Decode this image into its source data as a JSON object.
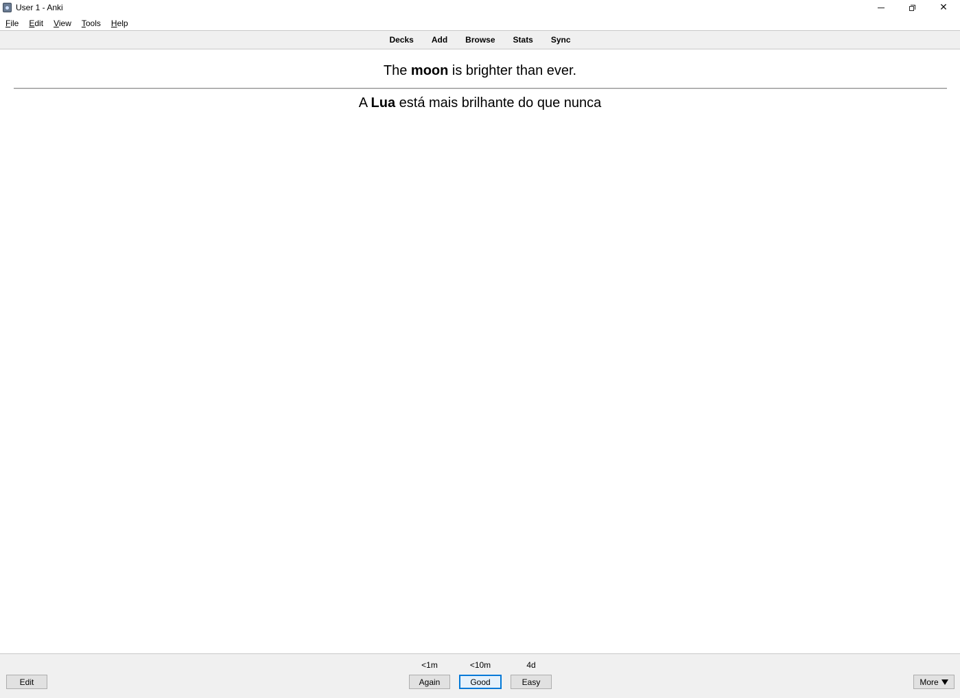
{
  "window": {
    "title": "User 1 - Anki"
  },
  "menu": [
    {
      "accel": "F",
      "rest": "ile"
    },
    {
      "accel": "E",
      "rest": "dit"
    },
    {
      "accel": "V",
      "rest": "iew"
    },
    {
      "accel": "T",
      "rest": "ools"
    },
    {
      "accel": "H",
      "rest": "elp"
    }
  ],
  "toolbar": {
    "decks": "Decks",
    "add": "Add",
    "browse": "Browse",
    "stats": "Stats",
    "sync": "Sync"
  },
  "card": {
    "front": {
      "before": "The ",
      "bold": "moon",
      "after": " is brighter than ever."
    },
    "back": {
      "before": "A ",
      "bold": "Lua",
      "after": " está mais brilhante do que nunca"
    }
  },
  "bottom": {
    "edit_label": "Edit",
    "again": {
      "label": "Again",
      "interval": "<1m"
    },
    "good": {
      "label": "Good",
      "interval": "<10m"
    },
    "easy": {
      "label": "Easy",
      "interval": "4d"
    },
    "more_label": "More"
  }
}
